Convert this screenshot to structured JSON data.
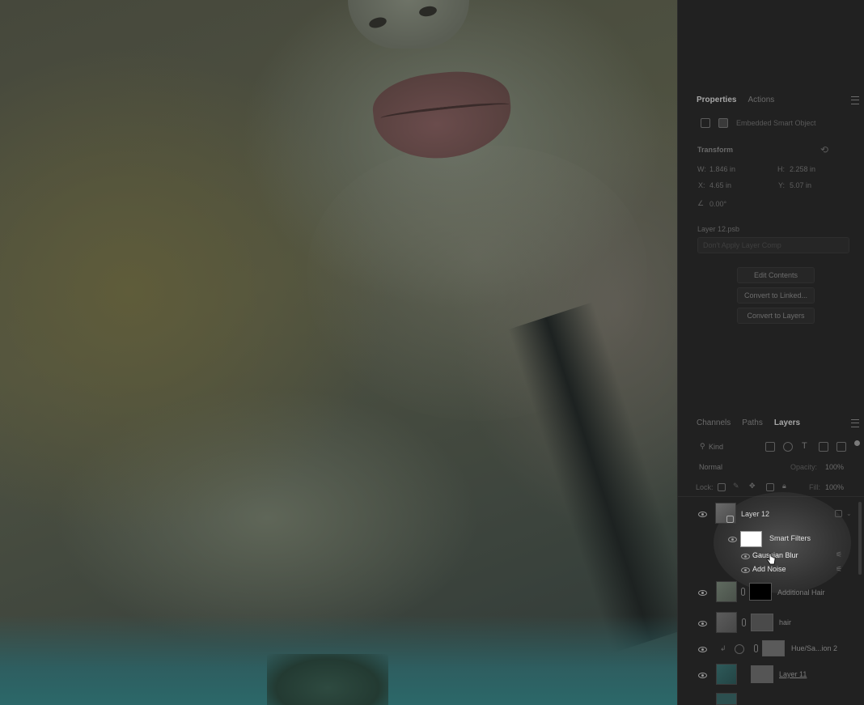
{
  "properties_panel": {
    "tabs": [
      {
        "label": "Properties",
        "active": true
      },
      {
        "label": "Actions",
        "active": false
      }
    ],
    "object_type": "Embedded Smart Object",
    "transform_label": "Transform",
    "w_label": "W:",
    "w_value": "1.846 in",
    "h_label": "H:",
    "h_value": "2.258 in",
    "x_label": "X:",
    "x_value": "4.65 in",
    "y_label": "Y:",
    "y_value": "5.07 in",
    "angle_value": "0.00°",
    "filename": "Layer 12.psb",
    "comp_placeholder": "Don't Apply Layer Comp",
    "buttons": {
      "edit_contents": "Edit Contents",
      "convert_linked": "Convert to Linked...",
      "convert_layers": "Convert to Layers"
    }
  },
  "layers_panel": {
    "tabs": [
      {
        "label": "Channels",
        "active": false
      },
      {
        "label": "Paths",
        "active": false
      },
      {
        "label": "Layers",
        "active": true
      }
    ],
    "filter_kind": "Kind",
    "blend_mode": "Normal",
    "opacity_label": "Opacity:",
    "opacity_value": "100%",
    "lock_label": "Lock:",
    "fill_label": "Fill:",
    "fill_value": "100%",
    "layers": {
      "layer12": "Layer 12",
      "smart_filters": "Smart Filters",
      "gaussian_blur": "Gaussian Blur",
      "add_noise": "Add Noise",
      "additional_hair": "Additional Hair",
      "hair": "hair",
      "hue_sat": "Hue/Sa...ion 2",
      "layer11": "Layer 11"
    }
  },
  "colors": {
    "panel_bg": "#212121",
    "panel_text": "#9a9a9a",
    "smart_filter_mask": "#ffffff",
    "layer_mask_black": "#000000"
  }
}
